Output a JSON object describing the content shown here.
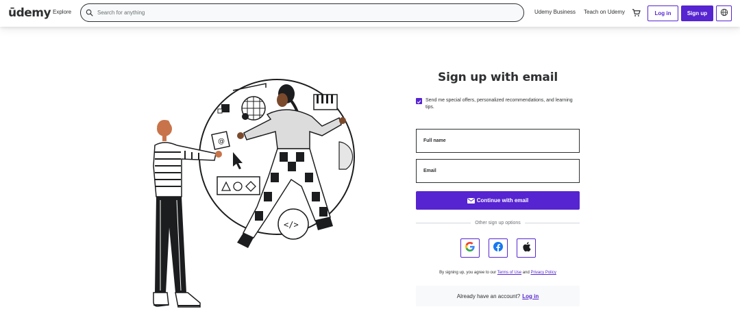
{
  "header": {
    "logo_text": "ūdemy",
    "explore": "Explore",
    "search": {
      "placeholder": "Search for anything"
    },
    "business": "Udemy Business",
    "teach": "Teach on Udemy",
    "login": "Log in",
    "signup": "Sign up"
  },
  "form": {
    "title": "Sign up with email",
    "checkbox_label": "Send me special offers, personalized recommendations, and learning tips.",
    "checkbox_checked": true,
    "fullname_label": "Full name",
    "email_label": "Email",
    "continue": "Continue with email",
    "other_options": "Other sign up options",
    "terms_prefix": "By signing up, you agree to our",
    "terms_link": "Terms of Use",
    "terms_and": "and",
    "privacy_link": "Privacy Policy",
    "already": "Already have an account?",
    "login_link": "Log in"
  },
  "colors": {
    "accent": "#5624d0",
    "text": "#2d2f31",
    "muted": "#6a6f73",
    "panel": "#f7f9fa"
  },
  "icons": [
    "search-icon",
    "cart-icon",
    "globe-icon",
    "mail-icon",
    "google-icon",
    "facebook-icon",
    "apple-icon",
    "checkmark-icon"
  ]
}
